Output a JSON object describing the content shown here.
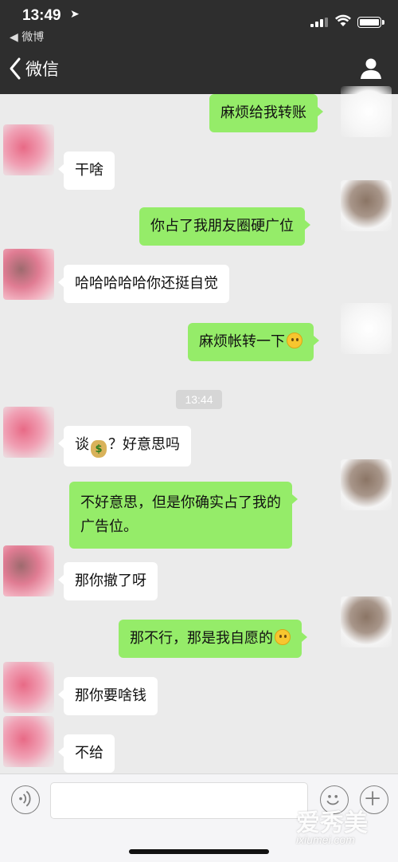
{
  "status_bar": {
    "time": "13:49",
    "back_app": "◀ 微博"
  },
  "nav": {
    "back_label": "微信"
  },
  "messages": [
    {
      "side": "out",
      "text": "麻烦给我转账"
    },
    {
      "side": "in",
      "text": "干啥"
    },
    {
      "side": "out",
      "text": "你占了我朋友圈硬广位"
    },
    {
      "side": "in",
      "text": "哈哈哈哈哈你还挺自觉"
    },
    {
      "side": "out",
      "text": "麻烦帐转一下"
    },
    {
      "side": "in",
      "text_before": "谈",
      "text_after": "？好意思吗"
    },
    {
      "side": "out",
      "text_line1": "不好意思，但是你确实占了我的",
      "text_line2": "广告位。"
    },
    {
      "side": "in",
      "text": "那你撤了呀"
    },
    {
      "side": "out",
      "text": "那不行，那是我自愿的"
    },
    {
      "side": "in",
      "text": "那你要啥钱"
    },
    {
      "side": "in",
      "text": "不给"
    }
  ],
  "timestamp": "13:44",
  "input": {
    "value": "",
    "placeholder": ""
  },
  "watermark": {
    "main": "爱秀美",
    "sub": "ixiumei.com"
  },
  "colors": {
    "outgoing_bubble": "#95ec69",
    "incoming_bubble": "#ffffff",
    "chat_background": "#ebebeb",
    "header": "#2e2e2e"
  },
  "icons": [
    "location-arrow-icon",
    "signal-icon",
    "wifi-icon",
    "battery-icon",
    "back-chevron-icon",
    "profile-icon",
    "voice-icon",
    "emoji-icon",
    "plus-icon",
    "smile-emoji-icon",
    "money-bag-emoji-icon"
  ]
}
